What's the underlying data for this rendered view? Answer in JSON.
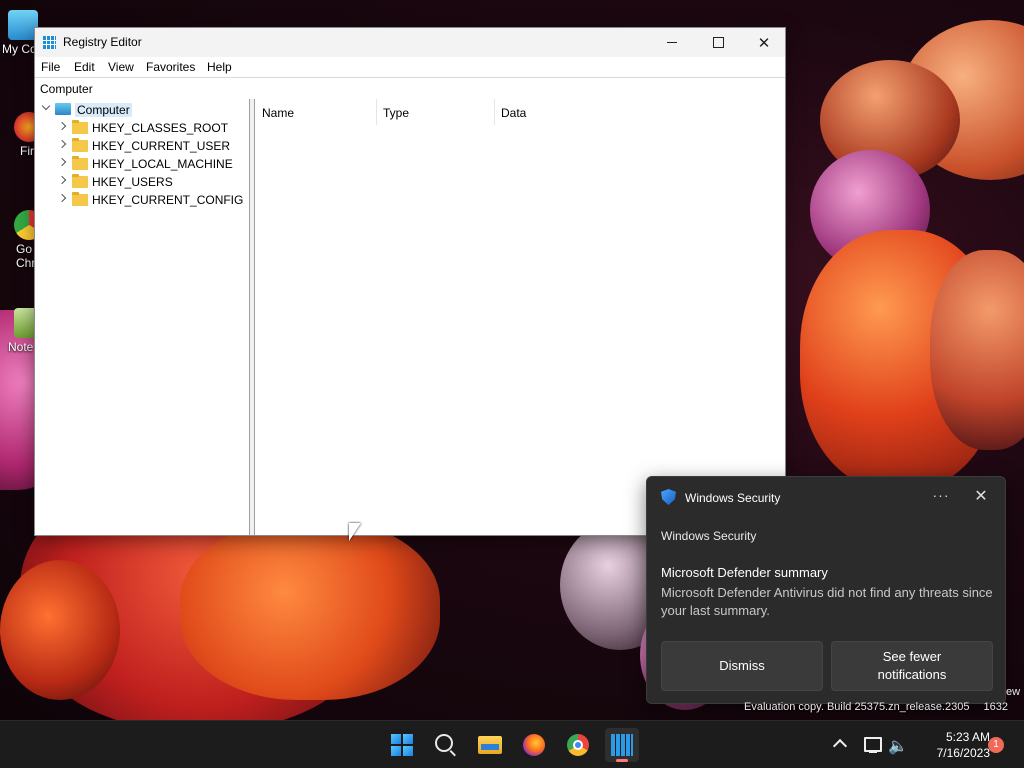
{
  "desktop": {
    "icons": [
      {
        "label": "My Co",
        "icon": "this-pc-icon"
      },
      {
        "label": "Fir",
        "icon": "firefox-icon"
      },
      {
        "label": "Go Chr",
        "icon": "chrome-icon"
      },
      {
        "label": "Note",
        "icon": "notepad-icon"
      }
    ]
  },
  "regedit": {
    "title": "Registry Editor",
    "menu": [
      "File",
      "Edit",
      "View",
      "Favorites",
      "Help"
    ],
    "address": "Computer",
    "tree": {
      "root": "Computer",
      "children": [
        "HKEY_CLASSES_ROOT",
        "HKEY_CURRENT_USER",
        "HKEY_LOCAL_MACHINE",
        "HKEY_USERS",
        "HKEY_CURRENT_CONFIG"
      ]
    },
    "columns": [
      "Name",
      "Type",
      "Data"
    ]
  },
  "toast": {
    "app_name": "Windows Security",
    "more_label": "···",
    "attribution": "Windows Security",
    "title": "Microsoft Defender summary",
    "body": "Microsoft Defender Antivirus did not find any threats since your last summary.",
    "buttons": {
      "dismiss": "Dismiss",
      "fewer": "See fewer notifications"
    }
  },
  "watermark": {
    "line": "Evaluation copy. Build 25375.zn_release.2305",
    "line_end": "1632",
    "edge": "ew"
  },
  "taskbar": {
    "items": [
      "start-icon",
      "search-icon",
      "file-explorer-icon",
      "firefox-icon",
      "chrome-icon",
      "registry-editor-icon"
    ],
    "time": "5:23 AM",
    "date": "7/16/2023",
    "notification_count": "1"
  },
  "colors": {
    "accent": "#1a8fd6",
    "toast_bg": "#2b2b2b",
    "taskbar_bg": "#1c1c1c",
    "badge": "#f06a5a"
  }
}
